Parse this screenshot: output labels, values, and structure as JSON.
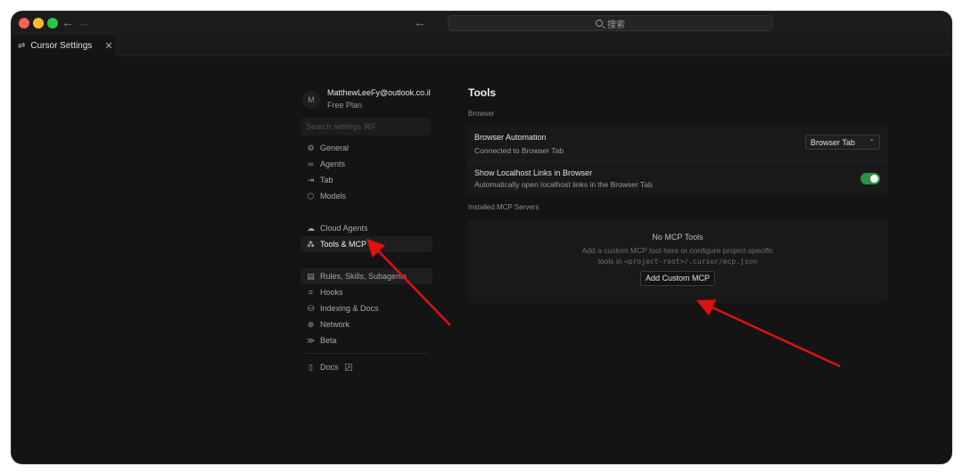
{
  "titlebar": {
    "search_text": "搜索",
    "back_icon": "back-arrow-icon",
    "forward_icon": "forward-arrow-icon"
  },
  "tab": {
    "label": "Cursor Settings",
    "close_glyph": "✕"
  },
  "account": {
    "initial": "M",
    "email": "MatthewLeeFy@outlook.co.il",
    "plan": "Free Plan"
  },
  "sidebar": {
    "search_placeholder": "Search settings ⌘F",
    "groups": [
      [
        {
          "label": "General",
          "icon": "gear-icon"
        },
        {
          "label": "Agents",
          "icon": "infinity-icon"
        },
        {
          "label": "Tab",
          "icon": "tab-arrow-icon"
        },
        {
          "label": "Models",
          "icon": "cube-icon"
        }
      ],
      [
        {
          "label": "Cloud Agents",
          "icon": "cloud-icon"
        },
        {
          "label": "Tools & MCP",
          "icon": "tools-icon",
          "active": true
        }
      ],
      [
        {
          "label": "Rules, Skills, Subagents",
          "icon": "document-icon"
        },
        {
          "label": "Hooks",
          "icon": "hooks-icon"
        },
        {
          "label": "Indexing & Docs",
          "icon": "database-icon"
        },
        {
          "label": "Network",
          "icon": "globe-icon"
        },
        {
          "label": "Beta",
          "icon": "beta-icon"
        }
      ]
    ],
    "docs": {
      "label": "Docs",
      "icon": "book-icon"
    }
  },
  "main": {
    "title": "Tools",
    "browser_section": "Browser",
    "browser_automation": {
      "title": "Browser Automation",
      "subtitle": "Connected to Browser Tab",
      "select_value": "Browser Tab"
    },
    "localhost_links": {
      "title": "Show Localhost Links in Browser",
      "subtitle": "Automatically open localhost links in the Browser Tab",
      "enabled": true
    },
    "mcp_section": "Installed MCP Servers",
    "mcp_empty": {
      "title": "No MCP Tools",
      "line1": "Add a custom MCP tool here or configure project-specific",
      "line2_prefix": "tools in ",
      "line2_code": "<project-root>/.cursor/mcp.json",
      "button": "Add Custom MCP"
    }
  },
  "colors": {
    "window_bg": "#141414",
    "toggle_on": "#2f8f46",
    "annotation_arrow": "#e01010"
  }
}
